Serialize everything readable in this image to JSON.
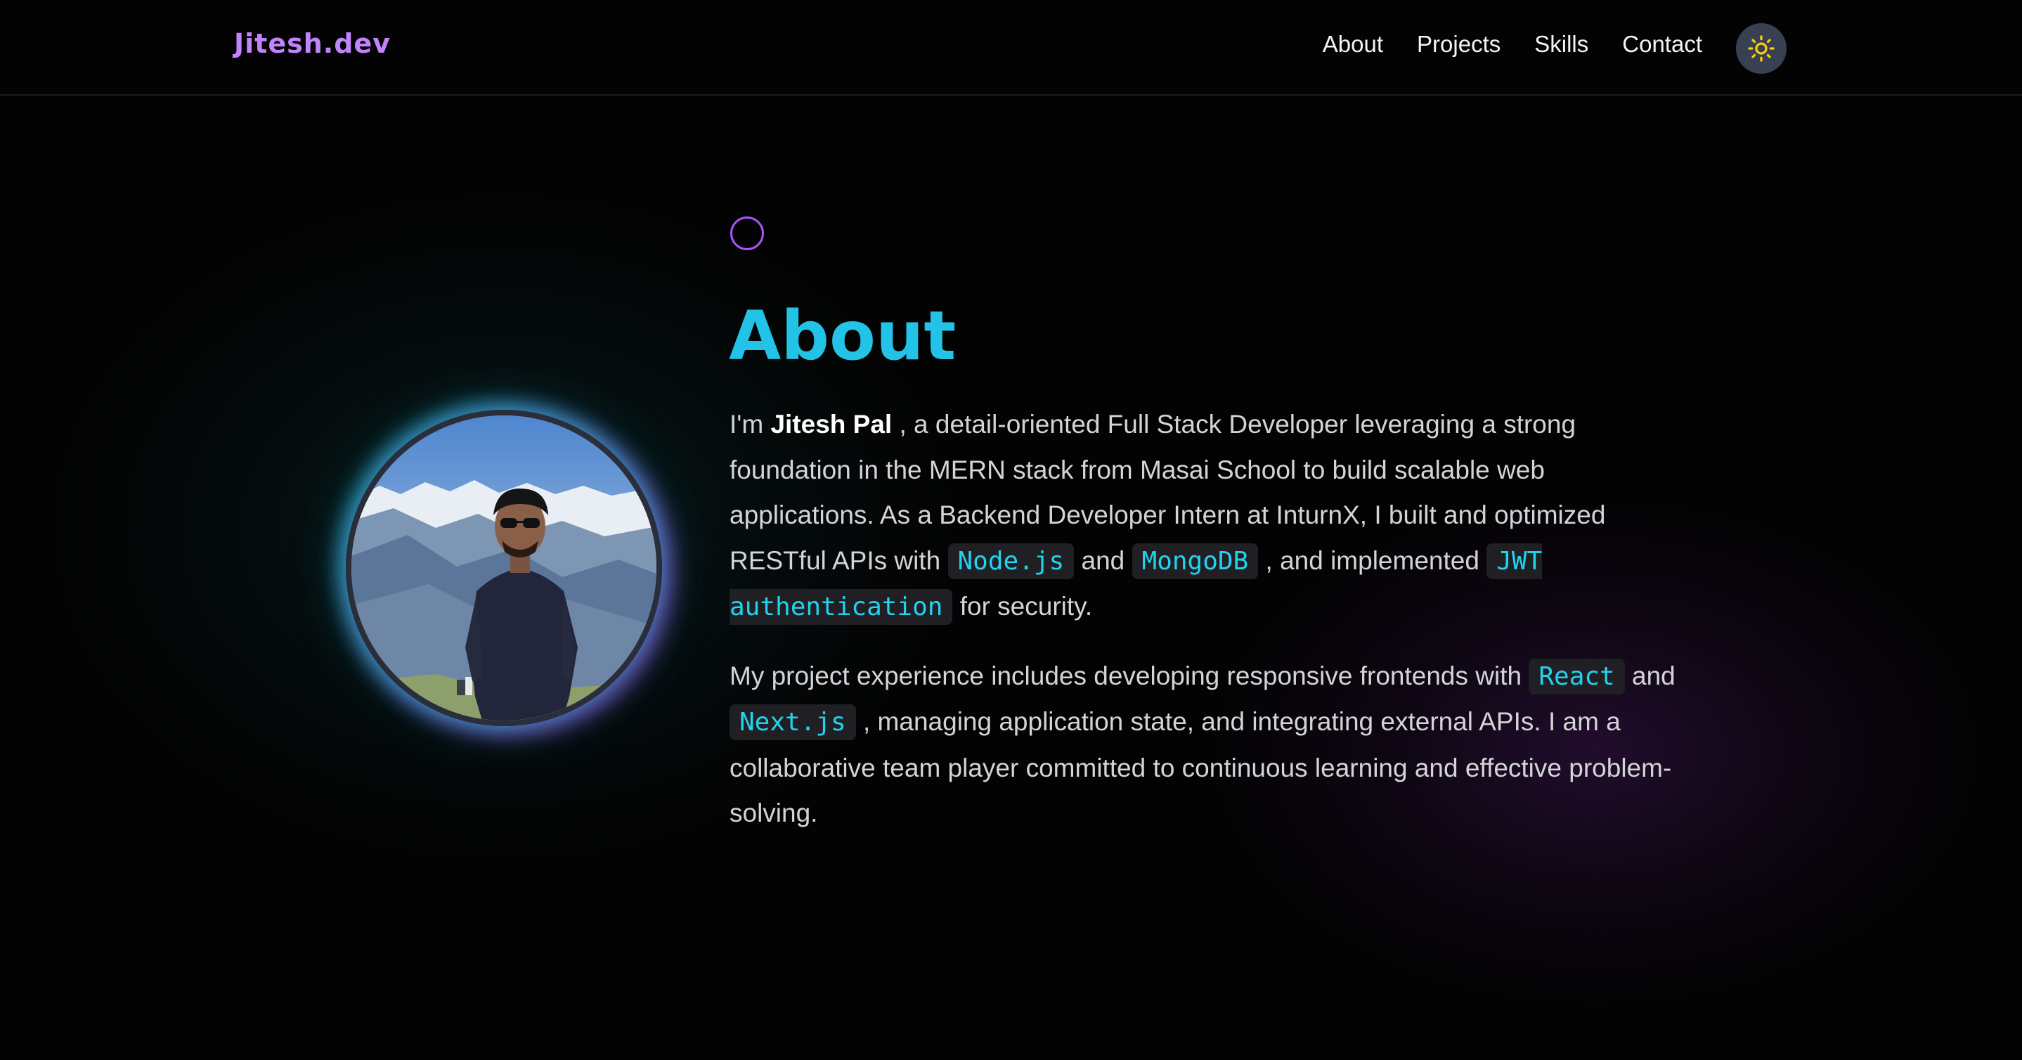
{
  "header": {
    "brand": "Jitesh.dev",
    "nav": [
      {
        "label": "About"
      },
      {
        "label": "Projects"
      },
      {
        "label": "Skills"
      },
      {
        "label": "Contact"
      }
    ],
    "theme_toggle_icon": "sun-icon"
  },
  "about": {
    "title": "About",
    "p1": {
      "intro": "I'm ",
      "name": "Jitesh Pal",
      "t1": " , a detail-oriented Full Stack Developer leveraging a strong foundation in the MERN stack from Masai School to build scalable web applications. As a Backend Developer Intern at InturnX, I built and optimized RESTful APIs with ",
      "c1": "Node.js",
      "t2": " and ",
      "c2": "MongoDB",
      "t3": " , and implemented ",
      "c3": "JWT authentication",
      "t4": " for security."
    },
    "p2": {
      "t1": "My project experience includes developing responsive frontends with ",
      "c1": "React",
      "t2": " and ",
      "c2": "Next.js",
      "t3": " , managing application state, and integrating external APIs. I am a collaborative team player committed to continuous learning and effective problem-solving."
    }
  },
  "colors": {
    "background": "#030303",
    "brand": "#c084fc",
    "heading": "#22c3e6",
    "code_text": "#22d3ee",
    "code_bg": "#1f1f24",
    "accent_purple": "#a855f7"
  }
}
